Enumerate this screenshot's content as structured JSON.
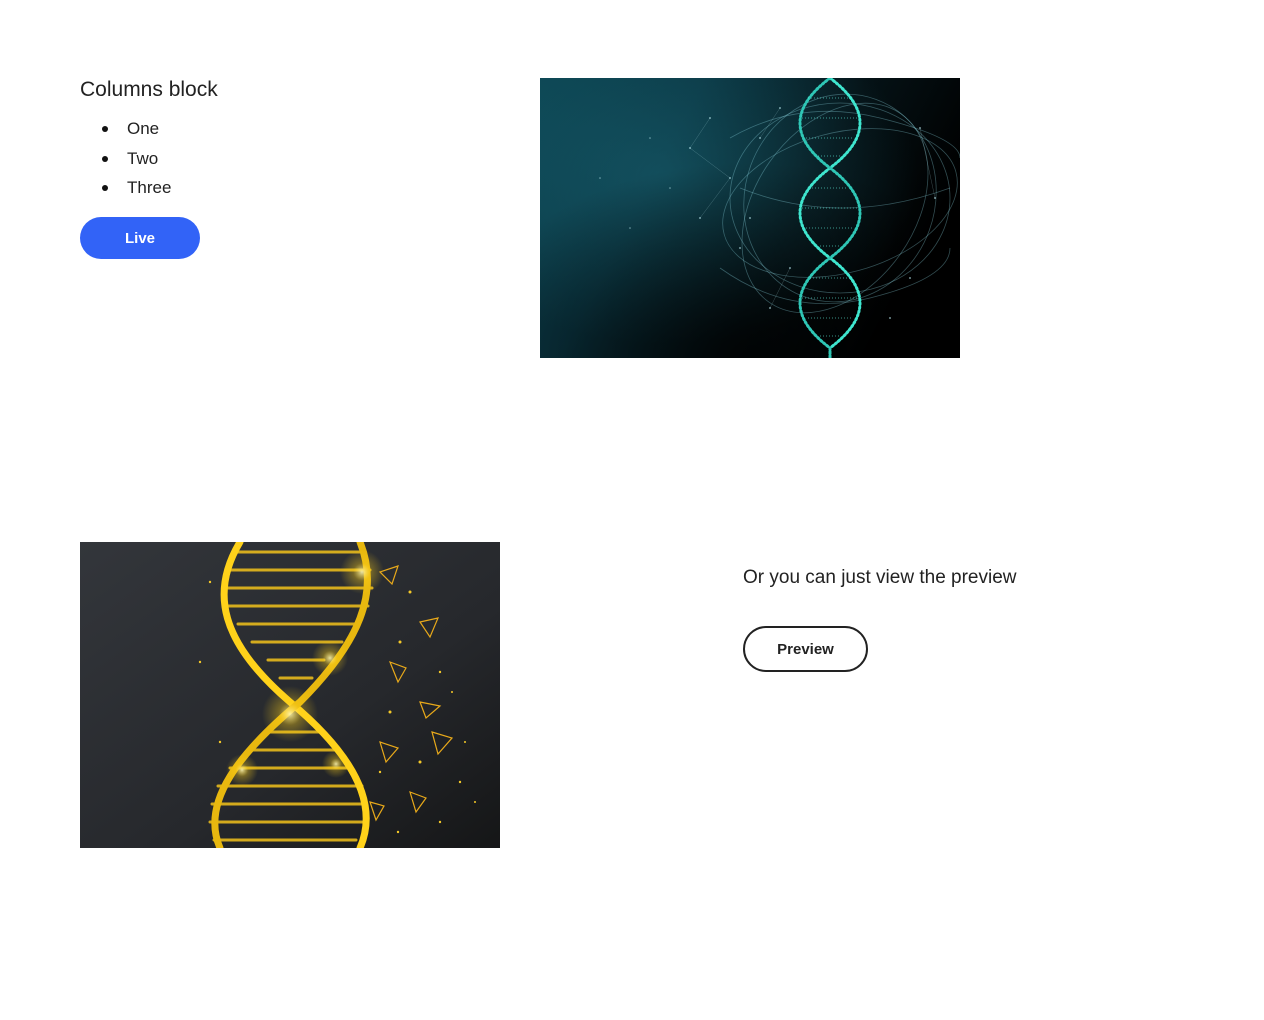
{
  "columns_block": {
    "heading": "Columns block",
    "list_items": [
      "One",
      "Two",
      "Three"
    ],
    "live_button_label": "Live",
    "live_button_color": "#3263f7"
  },
  "preview_section": {
    "text": "Or you can just view the preview",
    "preview_button_label": "Preview"
  },
  "images": {
    "top": {
      "subject": "teal-dna-helix-image",
      "palette": [
        "#0b3b47",
        "#000000",
        "#35e0c8"
      ]
    },
    "bottom": {
      "subject": "gold-dna-helix-image",
      "palette": [
        "#2c2f33",
        "#1a1a1a",
        "#ffd21a"
      ]
    }
  }
}
